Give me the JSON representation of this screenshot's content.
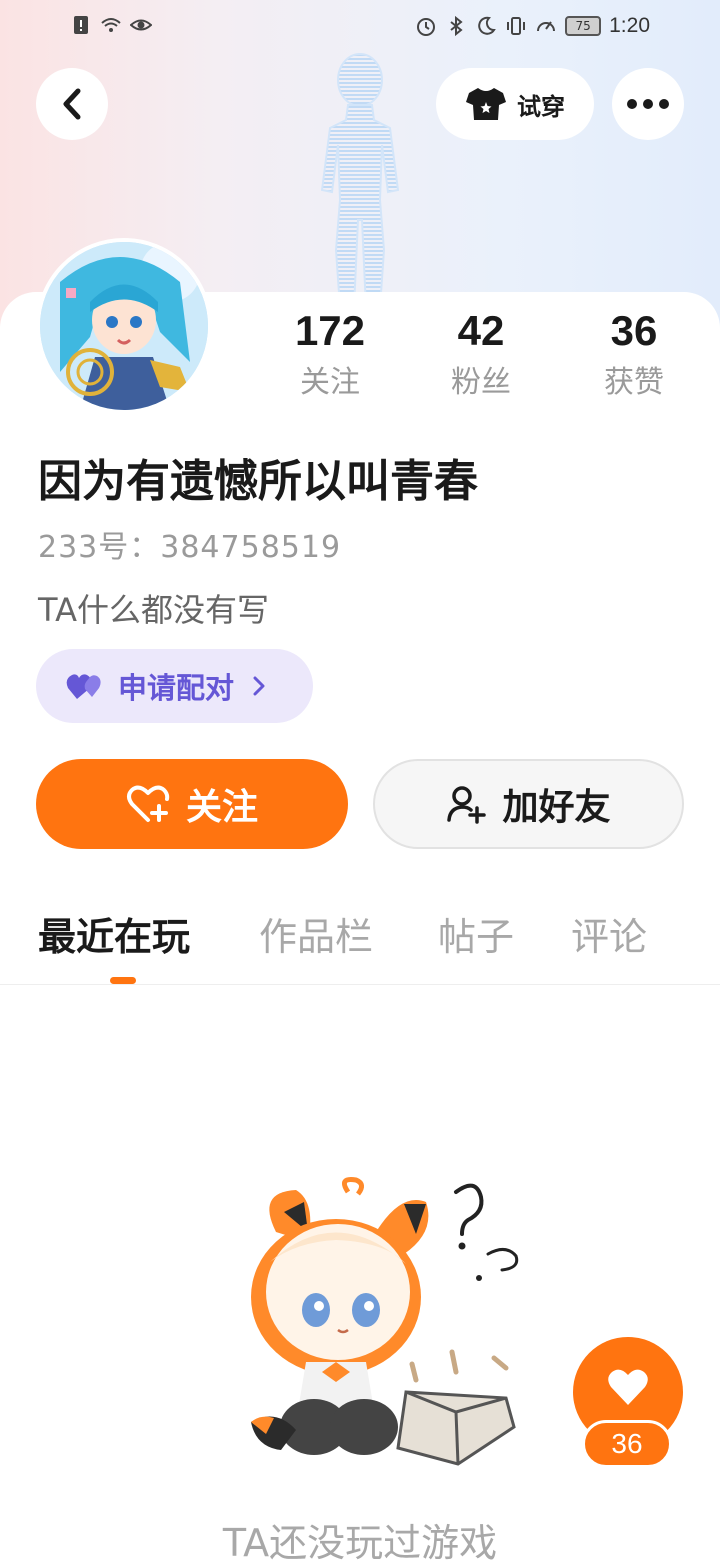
{
  "status_bar": {
    "battery": "75",
    "time": "1:20"
  },
  "header": {
    "try_on_label": "试穿"
  },
  "profile": {
    "stats": [
      {
        "value": "172",
        "label": "关注"
      },
      {
        "value": "42",
        "label": "粉丝"
      },
      {
        "value": "36",
        "label": "获赞"
      }
    ],
    "nickname": "因为有遗憾所以叫青春",
    "user_id": "233号：384758519",
    "bio": "TA什么都没有写",
    "pair_label": "申请配对"
  },
  "actions": {
    "follow_label": "关注",
    "add_friend_label": "加好友"
  },
  "tabs": [
    {
      "label": "最近在玩",
      "active": true
    },
    {
      "label": "作品栏",
      "active": false
    },
    {
      "label": "帖子",
      "active": false
    },
    {
      "label": "评论",
      "active": false
    }
  ],
  "empty_state": {
    "text": "TA还没玩过游戏"
  },
  "like_fab": {
    "count": "36"
  },
  "colors": {
    "accent": "#ff7410",
    "pair_bg": "#ece8fb",
    "pair_text": "#6557d6",
    "muted_text": "#9a9a9a"
  }
}
